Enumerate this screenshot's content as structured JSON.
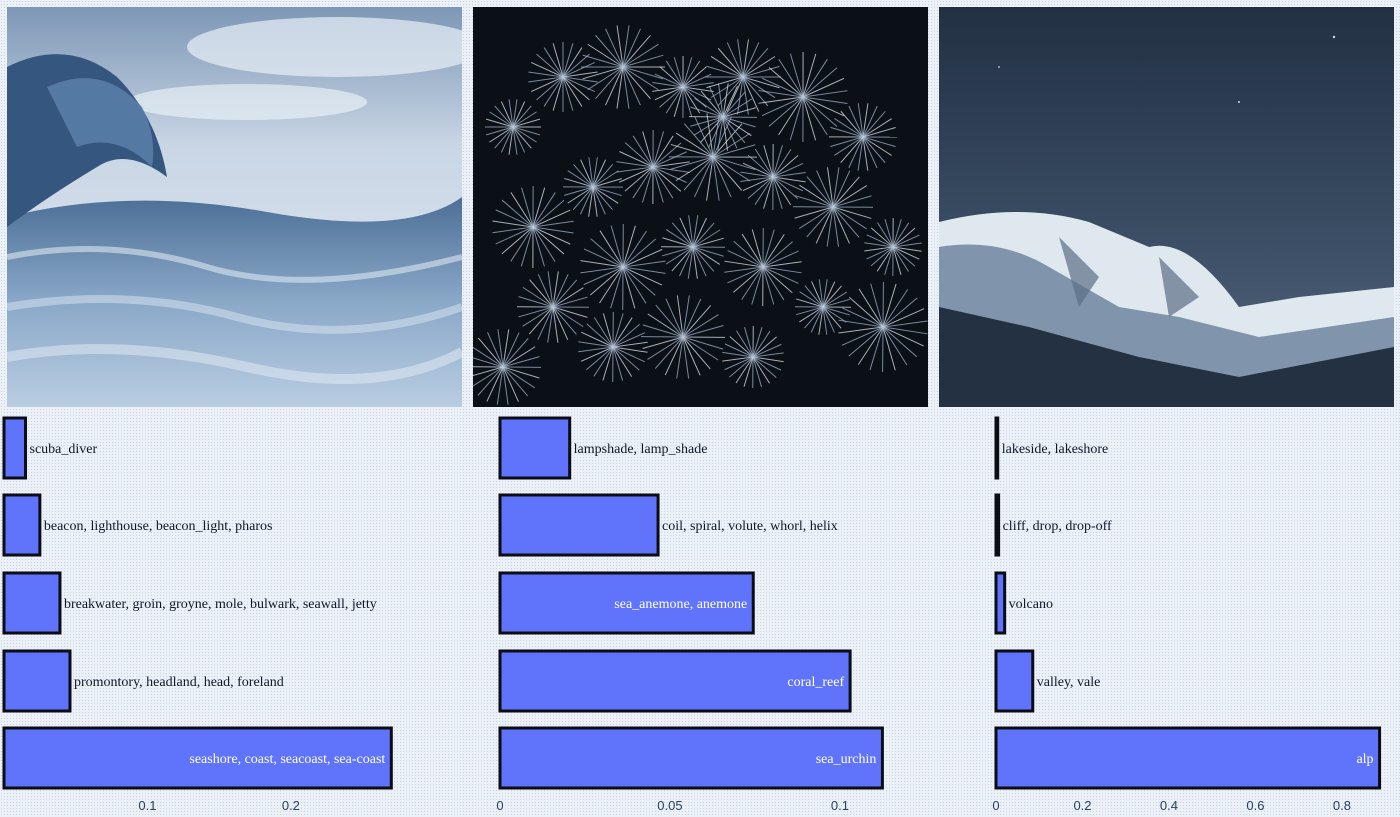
{
  "colors": {
    "bar": "#5f74fb",
    "bar_outline": "#0c0c14",
    "background": "#ecf1f8",
    "tick_text": "#2a3f5f"
  },
  "images": [
    {
      "name": "ocean-wave-photo"
    },
    {
      "name": "sea-urchin-photo"
    },
    {
      "name": "snowy-mountain-photo"
    }
  ],
  "chart_data": [
    {
      "type": "bar",
      "orientation": "horizontal",
      "categories": [
        "scuba_diver",
        "beacon, lighthouse, beacon_light, pharos",
        "breakwater, groin, groyne, mole, bulwark, seawall, jetty",
        "promontory, headland, head, foreland",
        "seashore, coast, seacoast, sea-coast"
      ],
      "values": [
        0.015,
        0.025,
        0.039,
        0.046,
        0.27
      ],
      "xlim": [
        0,
        0.29
      ],
      "xticks": [
        0.1,
        0.2
      ],
      "xtick_labels": [
        "0.1",
        "0.2"
      ]
    },
    {
      "type": "bar",
      "orientation": "horizontal",
      "categories": [
        "lampshade, lamp_shade",
        "coil, spiral, volute, whorl, helix",
        "sea_anemone, anemone",
        "coral_reef",
        "sea_urchin"
      ],
      "values": [
        0.0205,
        0.0465,
        0.0745,
        0.103,
        0.1125
      ],
      "xlim": [
        0,
        0.1165
      ],
      "xticks": [
        0,
        0.05,
        0.1
      ],
      "xtick_labels": [
        "0",
        "0.05",
        "0.1"
      ]
    },
    {
      "type": "bar",
      "orientation": "horizontal",
      "categories": [
        "lakeside, lakeshore",
        "cliff, drop, drop-off",
        "volcano",
        "valley, vale",
        "alp"
      ],
      "values": [
        0.004,
        0.006,
        0.02,
        0.085,
        0.887
      ],
      "xlim": [
        0,
        0.925
      ],
      "xticks": [
        0,
        0.2,
        0.4,
        0.6,
        0.8
      ],
      "xtick_labels": [
        "0",
        "0.2",
        "0.4",
        "0.6",
        "0.8"
      ]
    }
  ]
}
